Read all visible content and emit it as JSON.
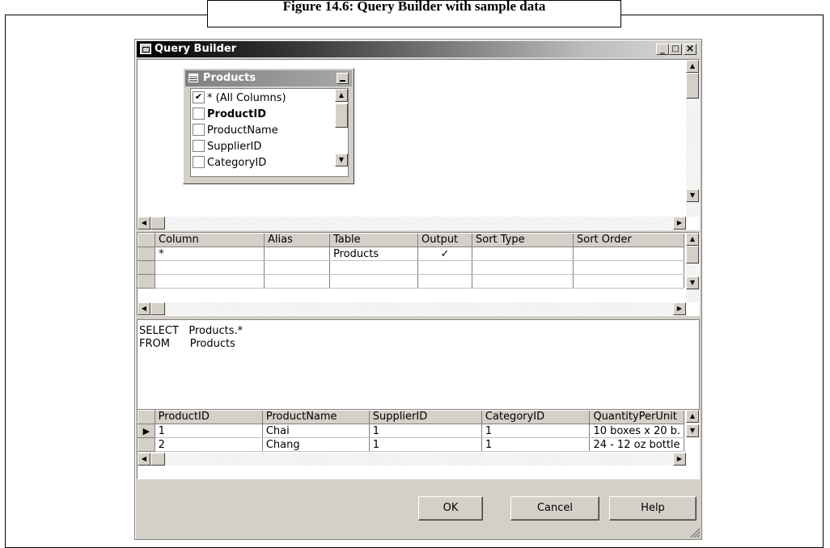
{
  "caption": "Figure 14.6: Query Builder with sample data",
  "window": {
    "title": "Query Builder",
    "minimize": "_",
    "maximize": "□",
    "close": "×"
  },
  "table_box": {
    "name": "Products",
    "columns": [
      {
        "label": "* (All Columns)",
        "checked": true,
        "bold": false
      },
      {
        "label": "ProductID",
        "checked": false,
        "bold": true
      },
      {
        "label": "ProductName",
        "checked": false,
        "bold": false
      },
      {
        "label": "SupplierID",
        "checked": false,
        "bold": false
      },
      {
        "label": "CategoryID",
        "checked": false,
        "bold": false
      }
    ]
  },
  "criteria_grid": {
    "headers": [
      "Column",
      "Alias",
      "Table",
      "Output",
      "Sort Type",
      "Sort Order"
    ],
    "rows": [
      [
        "*",
        "",
        "Products",
        "✓",
        "",
        ""
      ],
      [
        "",
        "",
        "",
        "",
        "",
        ""
      ],
      [
        "",
        "",
        "",
        "",
        "",
        ""
      ]
    ]
  },
  "sql": {
    "line1": "SELECT   Products.*",
    "line2": "FROM      Products"
  },
  "results_grid": {
    "headers": [
      "ProductID",
      "ProductName",
      "SupplierID",
      "CategoryID",
      "QuantityPerUnit"
    ],
    "rows": [
      [
        "1",
        "Chai",
        "1",
        "1",
        "10 boxes x 20 b."
      ],
      [
        "2",
        "Chang",
        "1",
        "1",
        "24 - 12 oz bottle"
      ]
    ],
    "current_row_marker": "▶"
  },
  "buttons": {
    "ok": "OK",
    "cancel": "Cancel",
    "help": "Help"
  },
  "icons": [
    "window-icon",
    "grid-icon",
    "checkbox-icon",
    "scroll-up-icon",
    "scroll-down-icon",
    "scroll-left-icon",
    "scroll-right-icon",
    "row-pointer-icon",
    "resize-grip-icon"
  ]
}
